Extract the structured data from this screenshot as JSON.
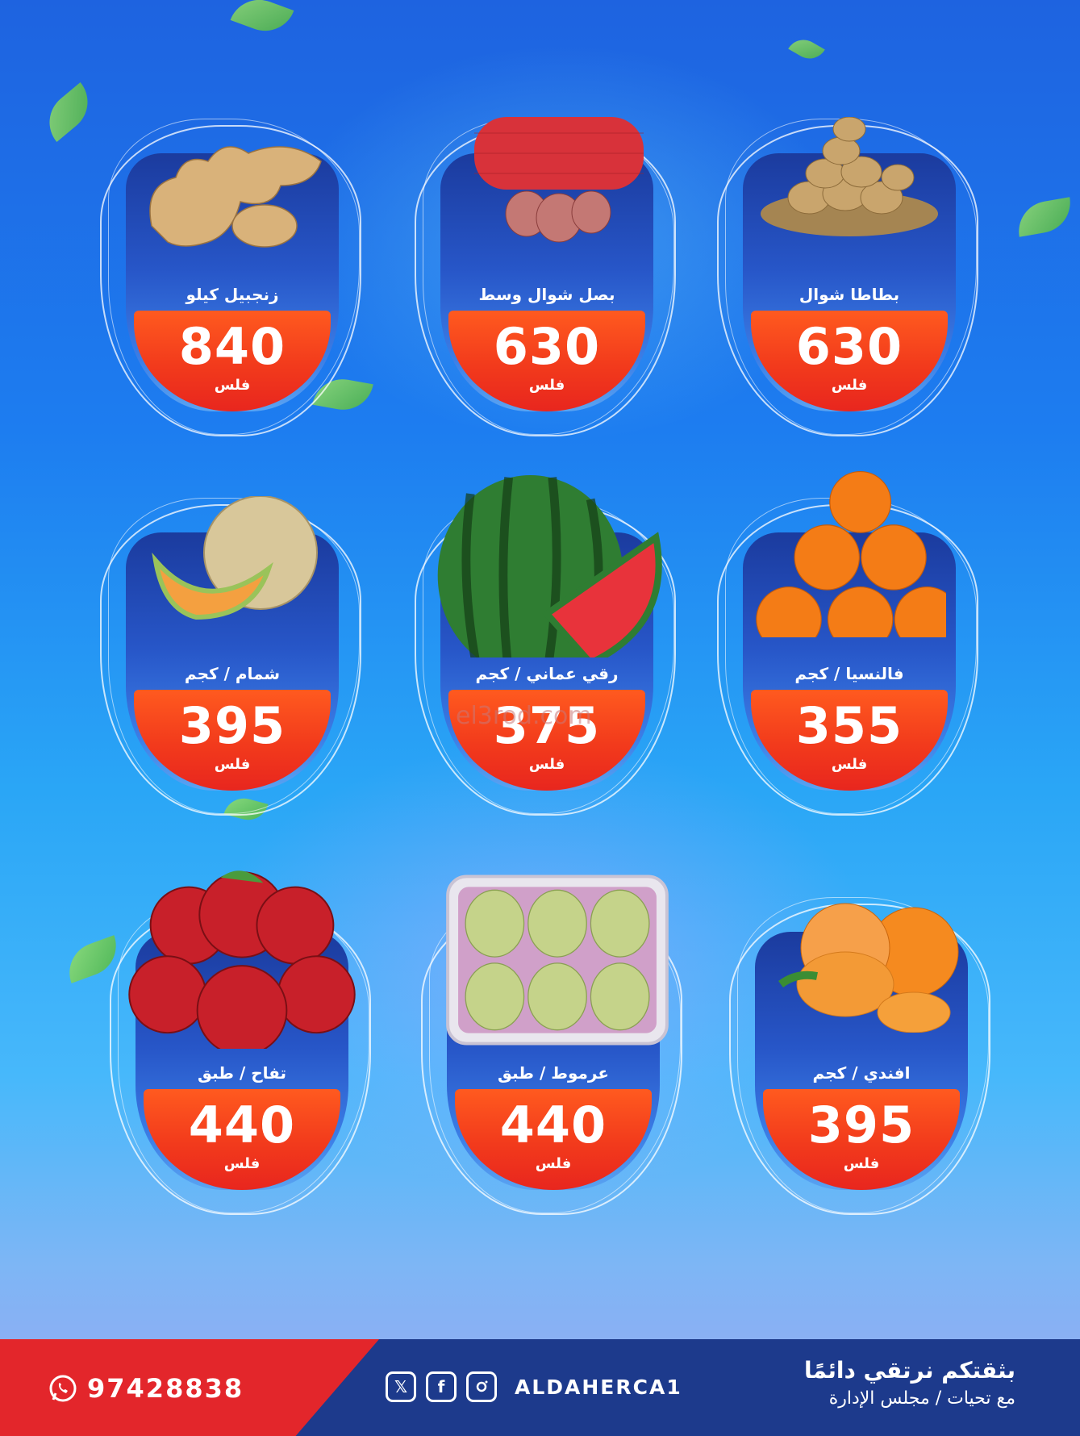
{
  "products": [
    {
      "name": "بطاطا شوال",
      "price": "630",
      "unit": "فلس",
      "image": "potatoes"
    },
    {
      "name": "بصل شوال وسط",
      "price": "630",
      "unit": "فلس",
      "image": "onions-in-net-bag"
    },
    {
      "name": "زنجبيل كيلو",
      "price": "840",
      "unit": "فلس",
      "image": "ginger"
    },
    {
      "name": "فالنسيا / كجم",
      "price": "355",
      "unit": "فلس",
      "image": "oranges"
    },
    {
      "name": "رقي عماني / كجم",
      "price": "375",
      "unit": "فلس",
      "image": "watermelon"
    },
    {
      "name": "شمام / كجم",
      "price": "395",
      "unit": "فلس",
      "image": "cantaloupe"
    },
    {
      "name": "افندي / كجم",
      "price": "395",
      "unit": "فلس",
      "image": "mandarins"
    },
    {
      "name": "عرموط / طبق",
      "price": "440",
      "unit": "فلس",
      "image": "pears-tray"
    },
    {
      "name": "تفاح / طبق",
      "price": "440",
      "unit": "فلس",
      "image": "apples"
    }
  ],
  "watermark": "el3rod.com",
  "footer": {
    "phone": "97428838",
    "handle": "ALDAHERCA1",
    "slogan_line1": "بثقتكم نرتقي دائمًا",
    "slogan_line2": "مع تحيات / مجلس الإدارة",
    "icons": [
      "whatsapp-icon",
      "x-icon",
      "facebook-icon",
      "instagram-icon"
    ]
  },
  "colors": {
    "background_top": "#1e63e0",
    "price_badge": "#f23a1c",
    "footer_blue": "#1d3a8c",
    "footer_red": "#e3262b"
  }
}
